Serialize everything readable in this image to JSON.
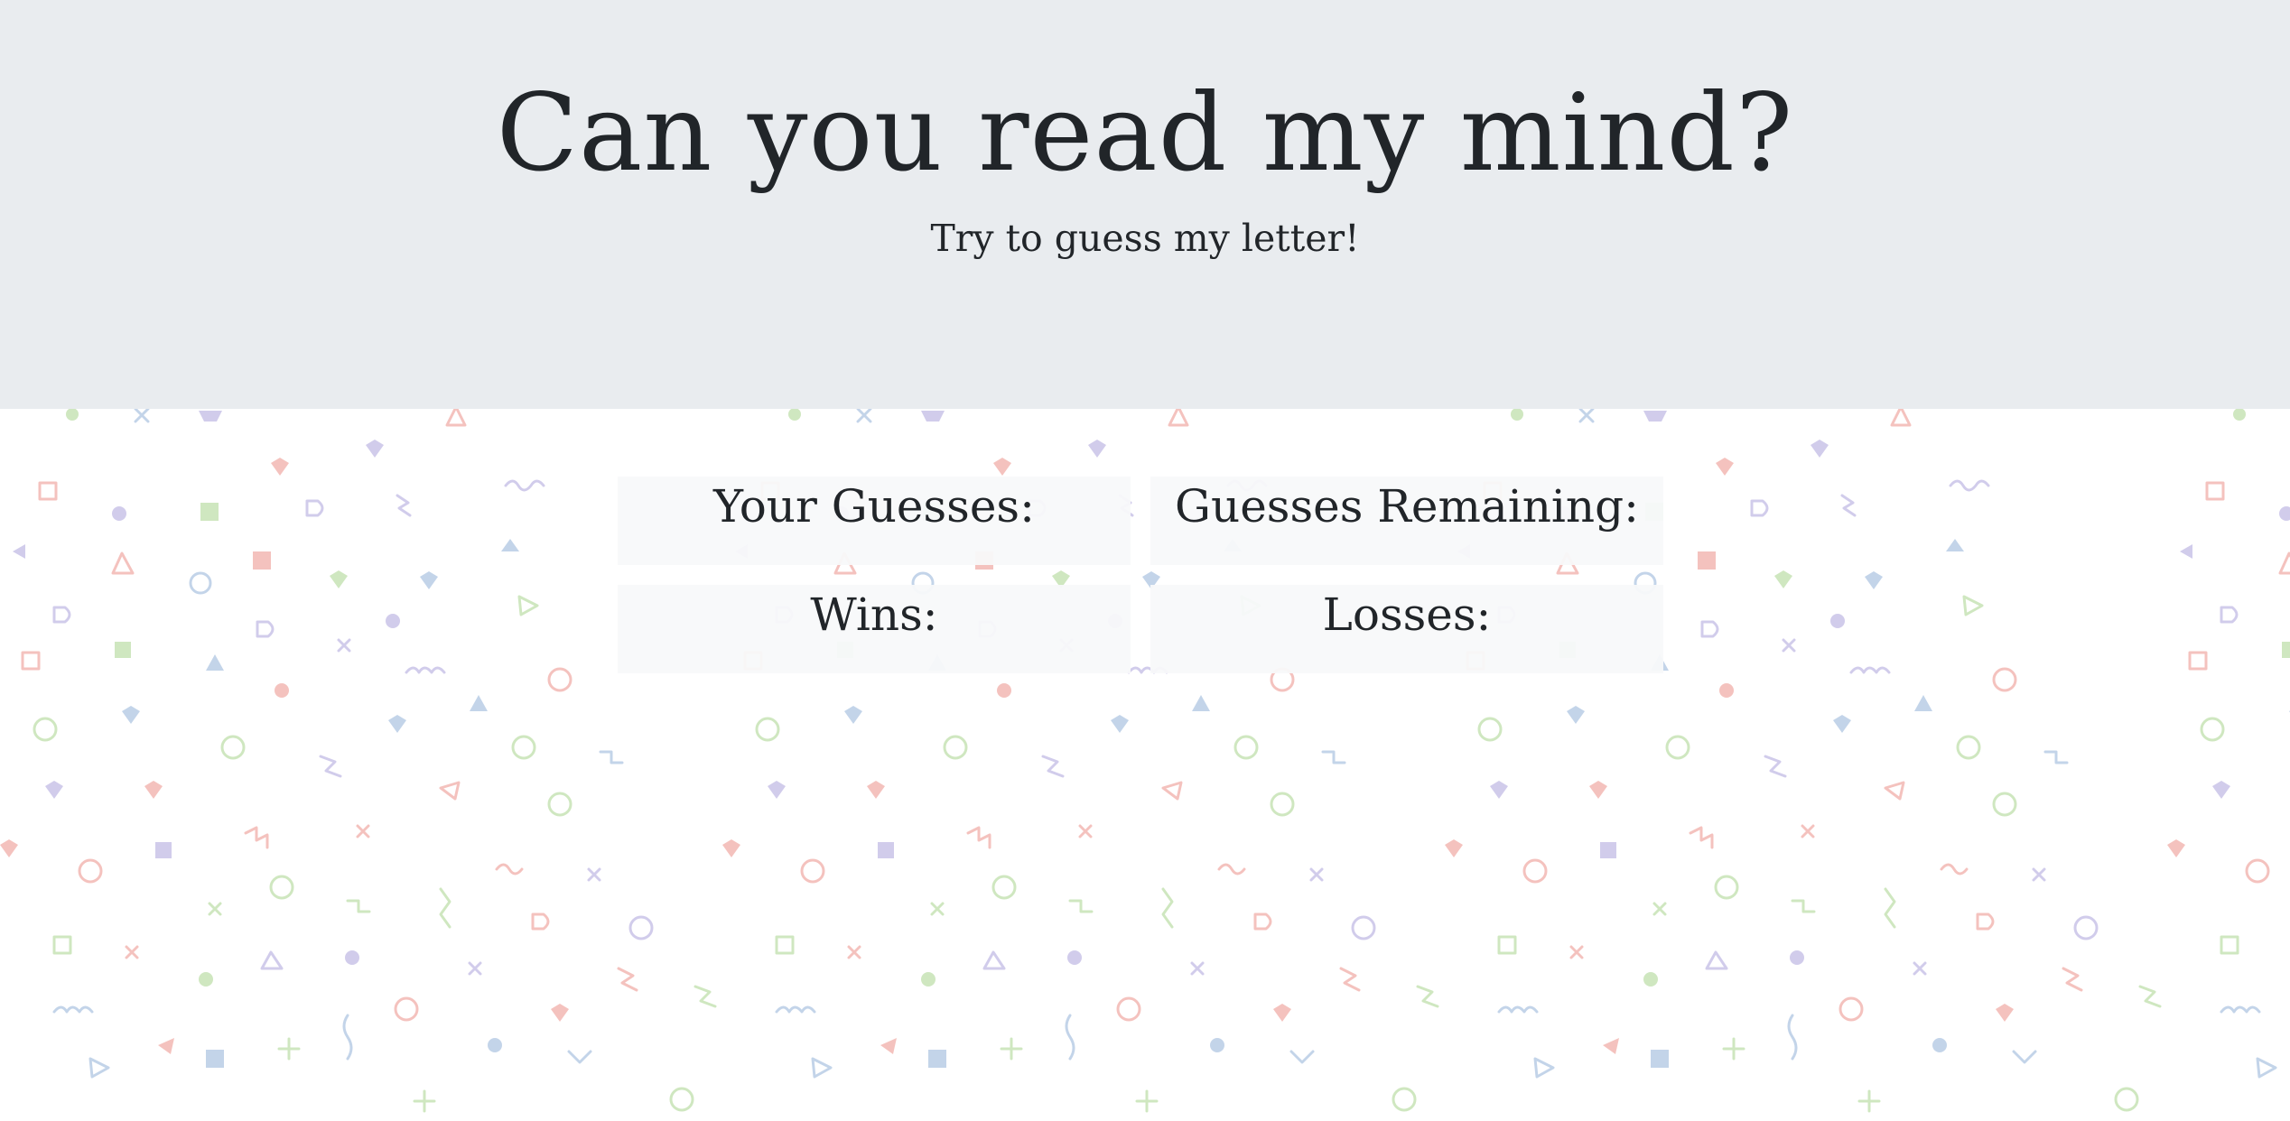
{
  "header": {
    "title": "Can you read my mind?",
    "subtitle": "Try to guess my letter!"
  },
  "stats": {
    "guesses_label": "Your Guesses:",
    "remaining_label": "Guesses Remaining:",
    "wins_label": "Wins:",
    "losses_label": "Losses:"
  },
  "colors": {
    "header_background": "#e9ecef",
    "text": "#212529",
    "stat_box_background": "#f8f9fa",
    "pattern_pink": "#f3b8b3",
    "pattern_purple": "#c9c3e8",
    "pattern_blue": "#b9cde6",
    "pattern_green": "#c7e3b5"
  }
}
